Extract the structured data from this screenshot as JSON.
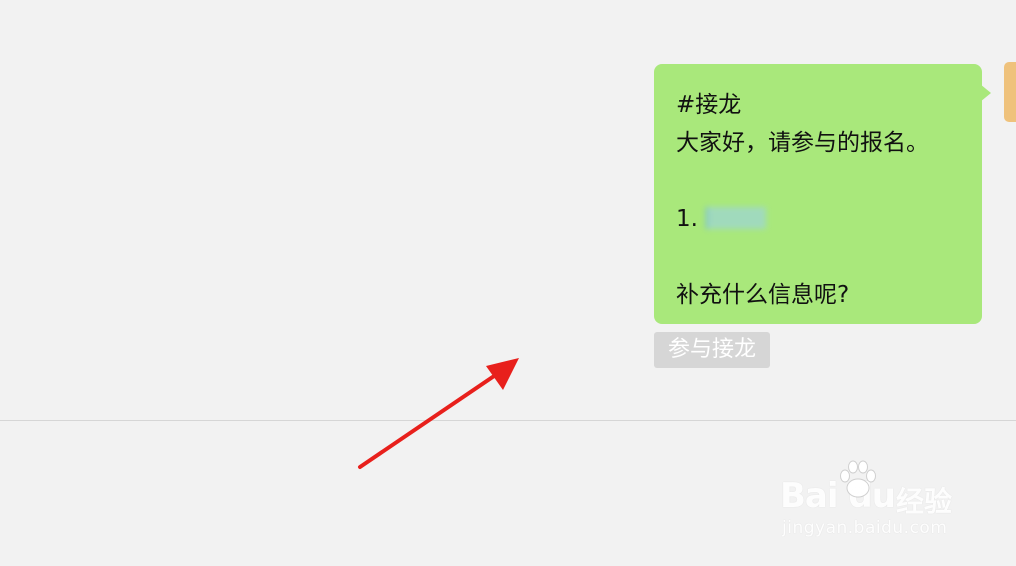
{
  "message": {
    "tag": "#接龙",
    "greeting": "大家好，请参与的报名。",
    "item_prefix": "1.",
    "question": "补充什么信息呢?"
  },
  "join_button": {
    "label": "参与接龙"
  },
  "watermark": {
    "logo_text": "Bai  du",
    "cn_text": "经验",
    "url": "jingyan.baidu.com"
  },
  "colors": {
    "background": "#f2f2f2",
    "bubble": "#a9e87b",
    "button": "#d6d6d6",
    "arrow": "#e8201c"
  }
}
